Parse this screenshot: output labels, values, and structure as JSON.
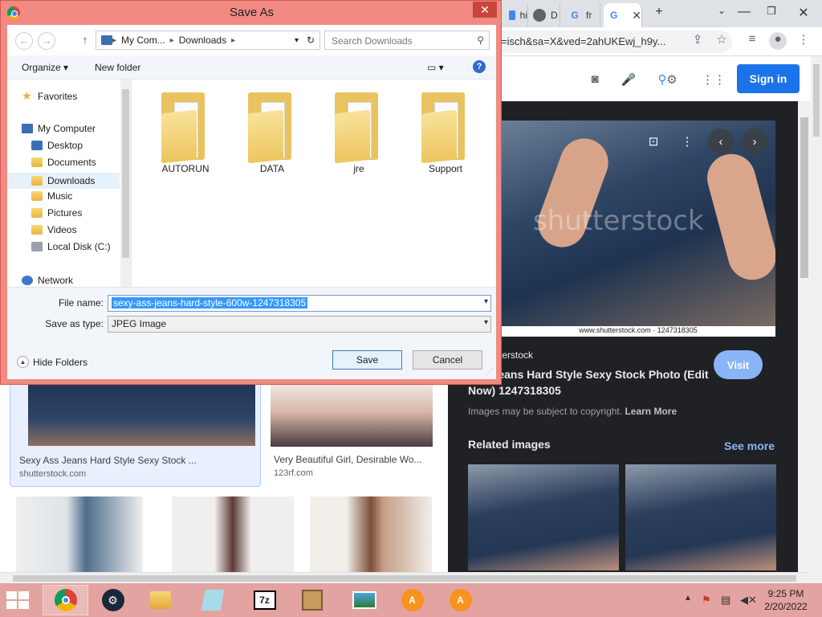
{
  "browser": {
    "tabs": [
      {
        "label": "hi",
        "fav": "google-doc-icon"
      },
      {
        "label": "D",
        "fav": "globe-icon"
      },
      {
        "label": "fr",
        "fav": "google-g-icon"
      },
      {
        "label": "",
        "fav": "google-g-icon",
        "active": true
      }
    ],
    "new_tab": "+",
    "url": "=isch&sa=X&ved=2ahUKEwj_h9y...",
    "sign_in": "Sign in"
  },
  "preview": {
    "watermark": "shutterstock",
    "caption": "www.shutterstock.com · 1247318305",
    "source": "terstock",
    "title": "Ass Jeans Hard Style Sexy Stock Photo (Edit Now) 1247318305",
    "visit": "Visit",
    "copyright_text": "Images may be subject to copyright.",
    "learn_more": "Learn More",
    "related": "Related images",
    "see_more": "See more"
  },
  "results": [
    {
      "title": "Sexy Ass Jeans Hard Style Sexy Stock ...",
      "source": "shutterstock.com"
    },
    {
      "title": "Very Beautiful Girl, Desirable Wo...",
      "source": "123rf.com"
    }
  ],
  "dialog": {
    "title": "Save As",
    "close": "✕",
    "address": [
      "My Com...",
      "Downloads"
    ],
    "search_placeholder": "Search Downloads",
    "organize": "Organize ▾",
    "new_folder": "New folder",
    "help": "?",
    "nav": {
      "favorites": "Favorites",
      "my_computer": "My Computer",
      "items": [
        "Desktop",
        "Documents",
        "Downloads",
        "Music",
        "Pictures",
        "Videos",
        "Local Disk (C:)"
      ],
      "network": "Network"
    },
    "folders": [
      "AUTORUN",
      "DATA",
      "jre",
      "Support"
    ],
    "file_name_label": "File name:",
    "file_name": "sexy-ass-jeans-hard-style-600w-1247318305",
    "save_type_label": "Save as type:",
    "save_type": "JPEG Image",
    "hide_folders": "Hide Folders",
    "save": "Save",
    "cancel": "Cancel"
  },
  "taskbar": {
    "apps": [
      "chrome-icon",
      "steam-icon",
      "file-explorer-icon",
      "notepad-icon",
      "7zip-icon",
      "app-icon",
      "photos-icon",
      "avast-icon",
      "avast-icon"
    ],
    "time": "9:25 PM",
    "date": "2/20/2022"
  }
}
